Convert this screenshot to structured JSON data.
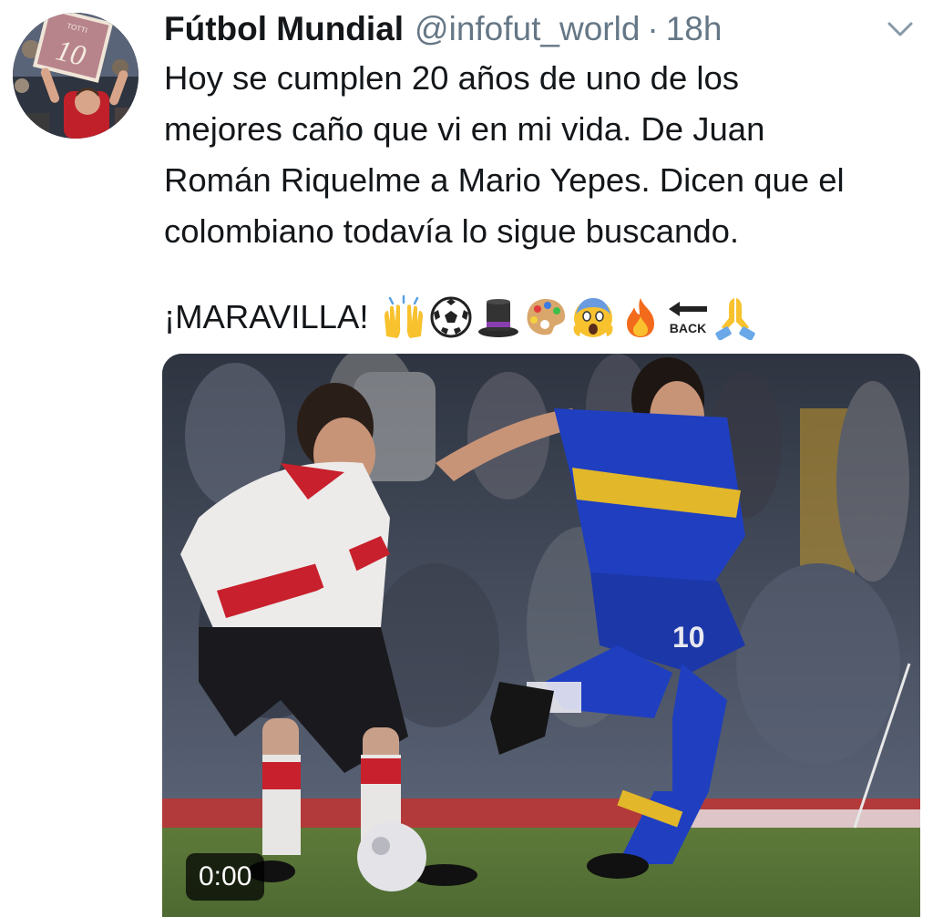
{
  "tweet": {
    "author_name": "Fútbol Mundial",
    "handle": "@infofut_world",
    "separator": "·",
    "time": "18h",
    "text": "Hoy se cumplen 20 años de uno de los\nmejores caño que vi en mi vida. De Juan\nRomán Riquelme a Mario Yepes. Dicen que el\ncolombiano todavía lo sigue buscando.",
    "exclaim": "¡MARAVILLA!",
    "emojis": [
      "raising-hands",
      "soccer-ball",
      "top-hat",
      "artist-palette",
      "screaming-face",
      "fire",
      "back-arrow",
      "folded-hands"
    ],
    "back_label": "BACK",
    "avatar_label": "10",
    "avatar_banner_text": "TOTTI"
  },
  "media": {
    "type": "video",
    "duration": "0:00"
  },
  "colors": {
    "text": "#14171a",
    "muted": "#657786",
    "boca_blue": "#1f3fc0",
    "boca_gold": "#e2b72a",
    "river_red": "#c8202c"
  }
}
